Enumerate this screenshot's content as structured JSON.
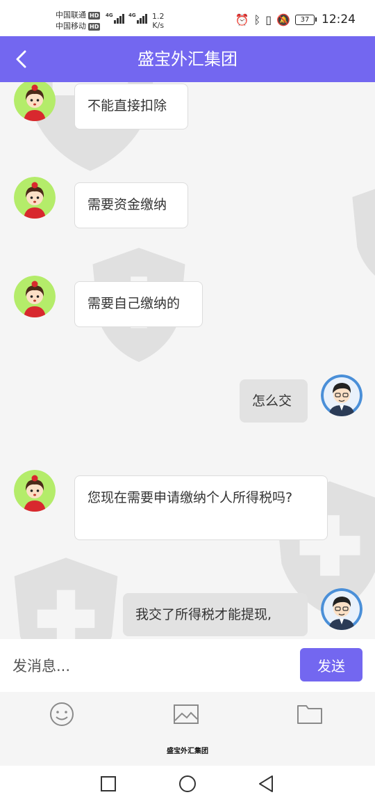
{
  "status_bar": {
    "carrier1": "中国联通",
    "carrier2": "中国移动",
    "hd": "HD",
    "net_type": "4G",
    "speed_value": "1.2",
    "speed_unit": "K/s",
    "battery": "37",
    "time": "12:24"
  },
  "header": {
    "title": "盛宝外汇集团"
  },
  "messages": [
    {
      "side": "in",
      "text": "不能直接扣除"
    },
    {
      "side": "in",
      "text": "需要资金缴纳"
    },
    {
      "side": "in",
      "text": "需要自己缴纳的"
    },
    {
      "side": "out",
      "text": "怎么交"
    },
    {
      "side": "in",
      "text": "您现在需要申请缴纳个人所得税吗?"
    },
    {
      "side": "out",
      "text": "我交了所得税才能提现,"
    }
  ],
  "input": {
    "placeholder": "发消息...",
    "send_label": "发送"
  },
  "toolbar": {
    "icons": [
      "emoji-icon",
      "image-icon",
      "folder-icon"
    ]
  },
  "footer": {
    "label": "盛宝外汇集团"
  },
  "colors": {
    "brand": "#7367f0",
    "incoming_bubble": "#ffffff",
    "outgoing_bubble": "#e2e2e2"
  }
}
